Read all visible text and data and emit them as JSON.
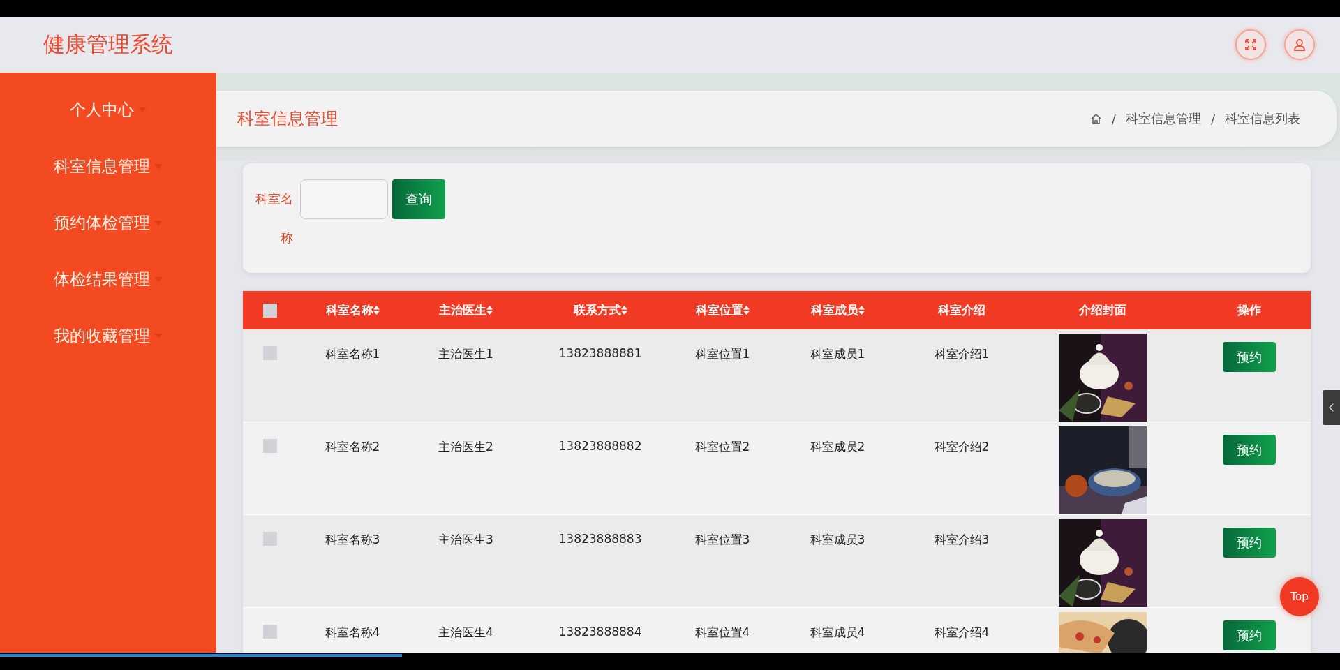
{
  "app_title": "健康管理系统",
  "sidebar": {
    "items": [
      {
        "label": "个人中心"
      },
      {
        "label": "科室信息管理"
      },
      {
        "label": "预约体检管理"
      },
      {
        "label": "体检结果管理"
      },
      {
        "label": "我的收藏管理"
      }
    ]
  },
  "page_title": "科室信息管理",
  "breadcrumb": [
    {
      "separator": "/",
      "label": "科室信息管理"
    },
    {
      "separator": "/",
      "label": "科室信息列表"
    }
  ],
  "search": {
    "label": "科室名称",
    "button": "查询"
  },
  "table": {
    "header_checked": false,
    "columns": [
      {
        "label": "科室名称",
        "sortable": true
      },
      {
        "label": "主治医生",
        "sortable": true
      },
      {
        "label": "联系方式",
        "sortable": true
      },
      {
        "label": "科室位置",
        "sortable": true
      },
      {
        "label": "科室成员",
        "sortable": true
      },
      {
        "label": "科室介绍",
        "sortable": false
      },
      {
        "label": "介绍封面",
        "sortable": false
      },
      {
        "label": "操作",
        "sortable": false
      }
    ],
    "rows": [
      {
        "checked": false,
        "cells": [
          "科室名称1",
          "主治医生1",
          "13823888881",
          "科室位置1",
          "科室成员1",
          "科室介绍1"
        ],
        "action": "预约"
      },
      {
        "checked": false,
        "cells": [
          "科室名称2",
          "主治医生2",
          "13823888882",
          "科室位置2",
          "科室成员2",
          "科室介绍2"
        ],
        "action": "预约"
      },
      {
        "checked": false,
        "cells": [
          "科室名称3",
          "主治医生3",
          "13823888883",
          "科室位置3",
          "科室成员3",
          "科室介绍3"
        ],
        "action": "预约"
      },
      {
        "checked": false,
        "cells": [
          "科室名称4",
          "主治医生4",
          "13823888884",
          "科室位置4",
          "科室成员4",
          "科室介绍4"
        ],
        "action": "预约"
      }
    ]
  },
  "back_to_top": "Top",
  "video_progress": {
    "level": 0.3
  }
}
